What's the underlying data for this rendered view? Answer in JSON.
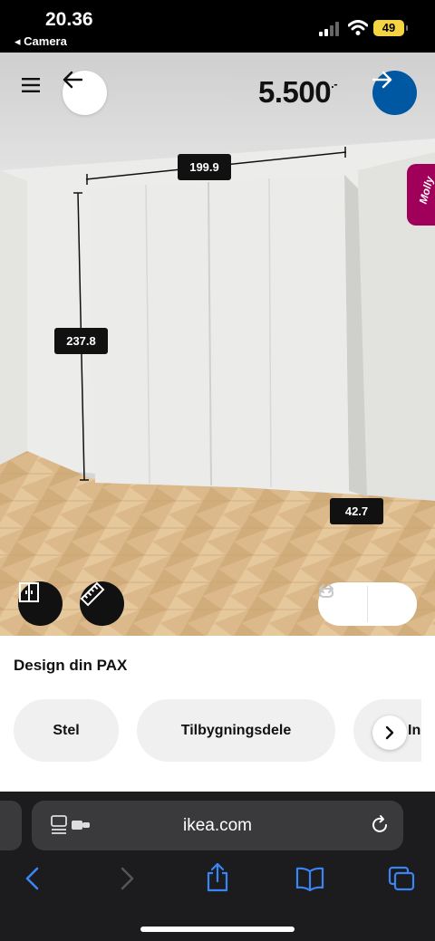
{
  "status_bar": {
    "time": "20.36",
    "back_app": "◂ Camera",
    "battery": "49"
  },
  "header": {
    "price": "5.500",
    "price_suffix": ".-"
  },
  "dimensions": {
    "width": "199.9",
    "height": "237.8",
    "depth": "42.7"
  },
  "assistant_tab": "Molly",
  "panel": {
    "heading": "Design din PAX",
    "categories": [
      "Stel",
      "Tilbygningsdele",
      "Ind"
    ]
  },
  "browser": {
    "url": "ikea.com"
  },
  "colors": {
    "accent": "#0058a3",
    "assistant": "#a0005a",
    "label_bg": "#111111"
  }
}
